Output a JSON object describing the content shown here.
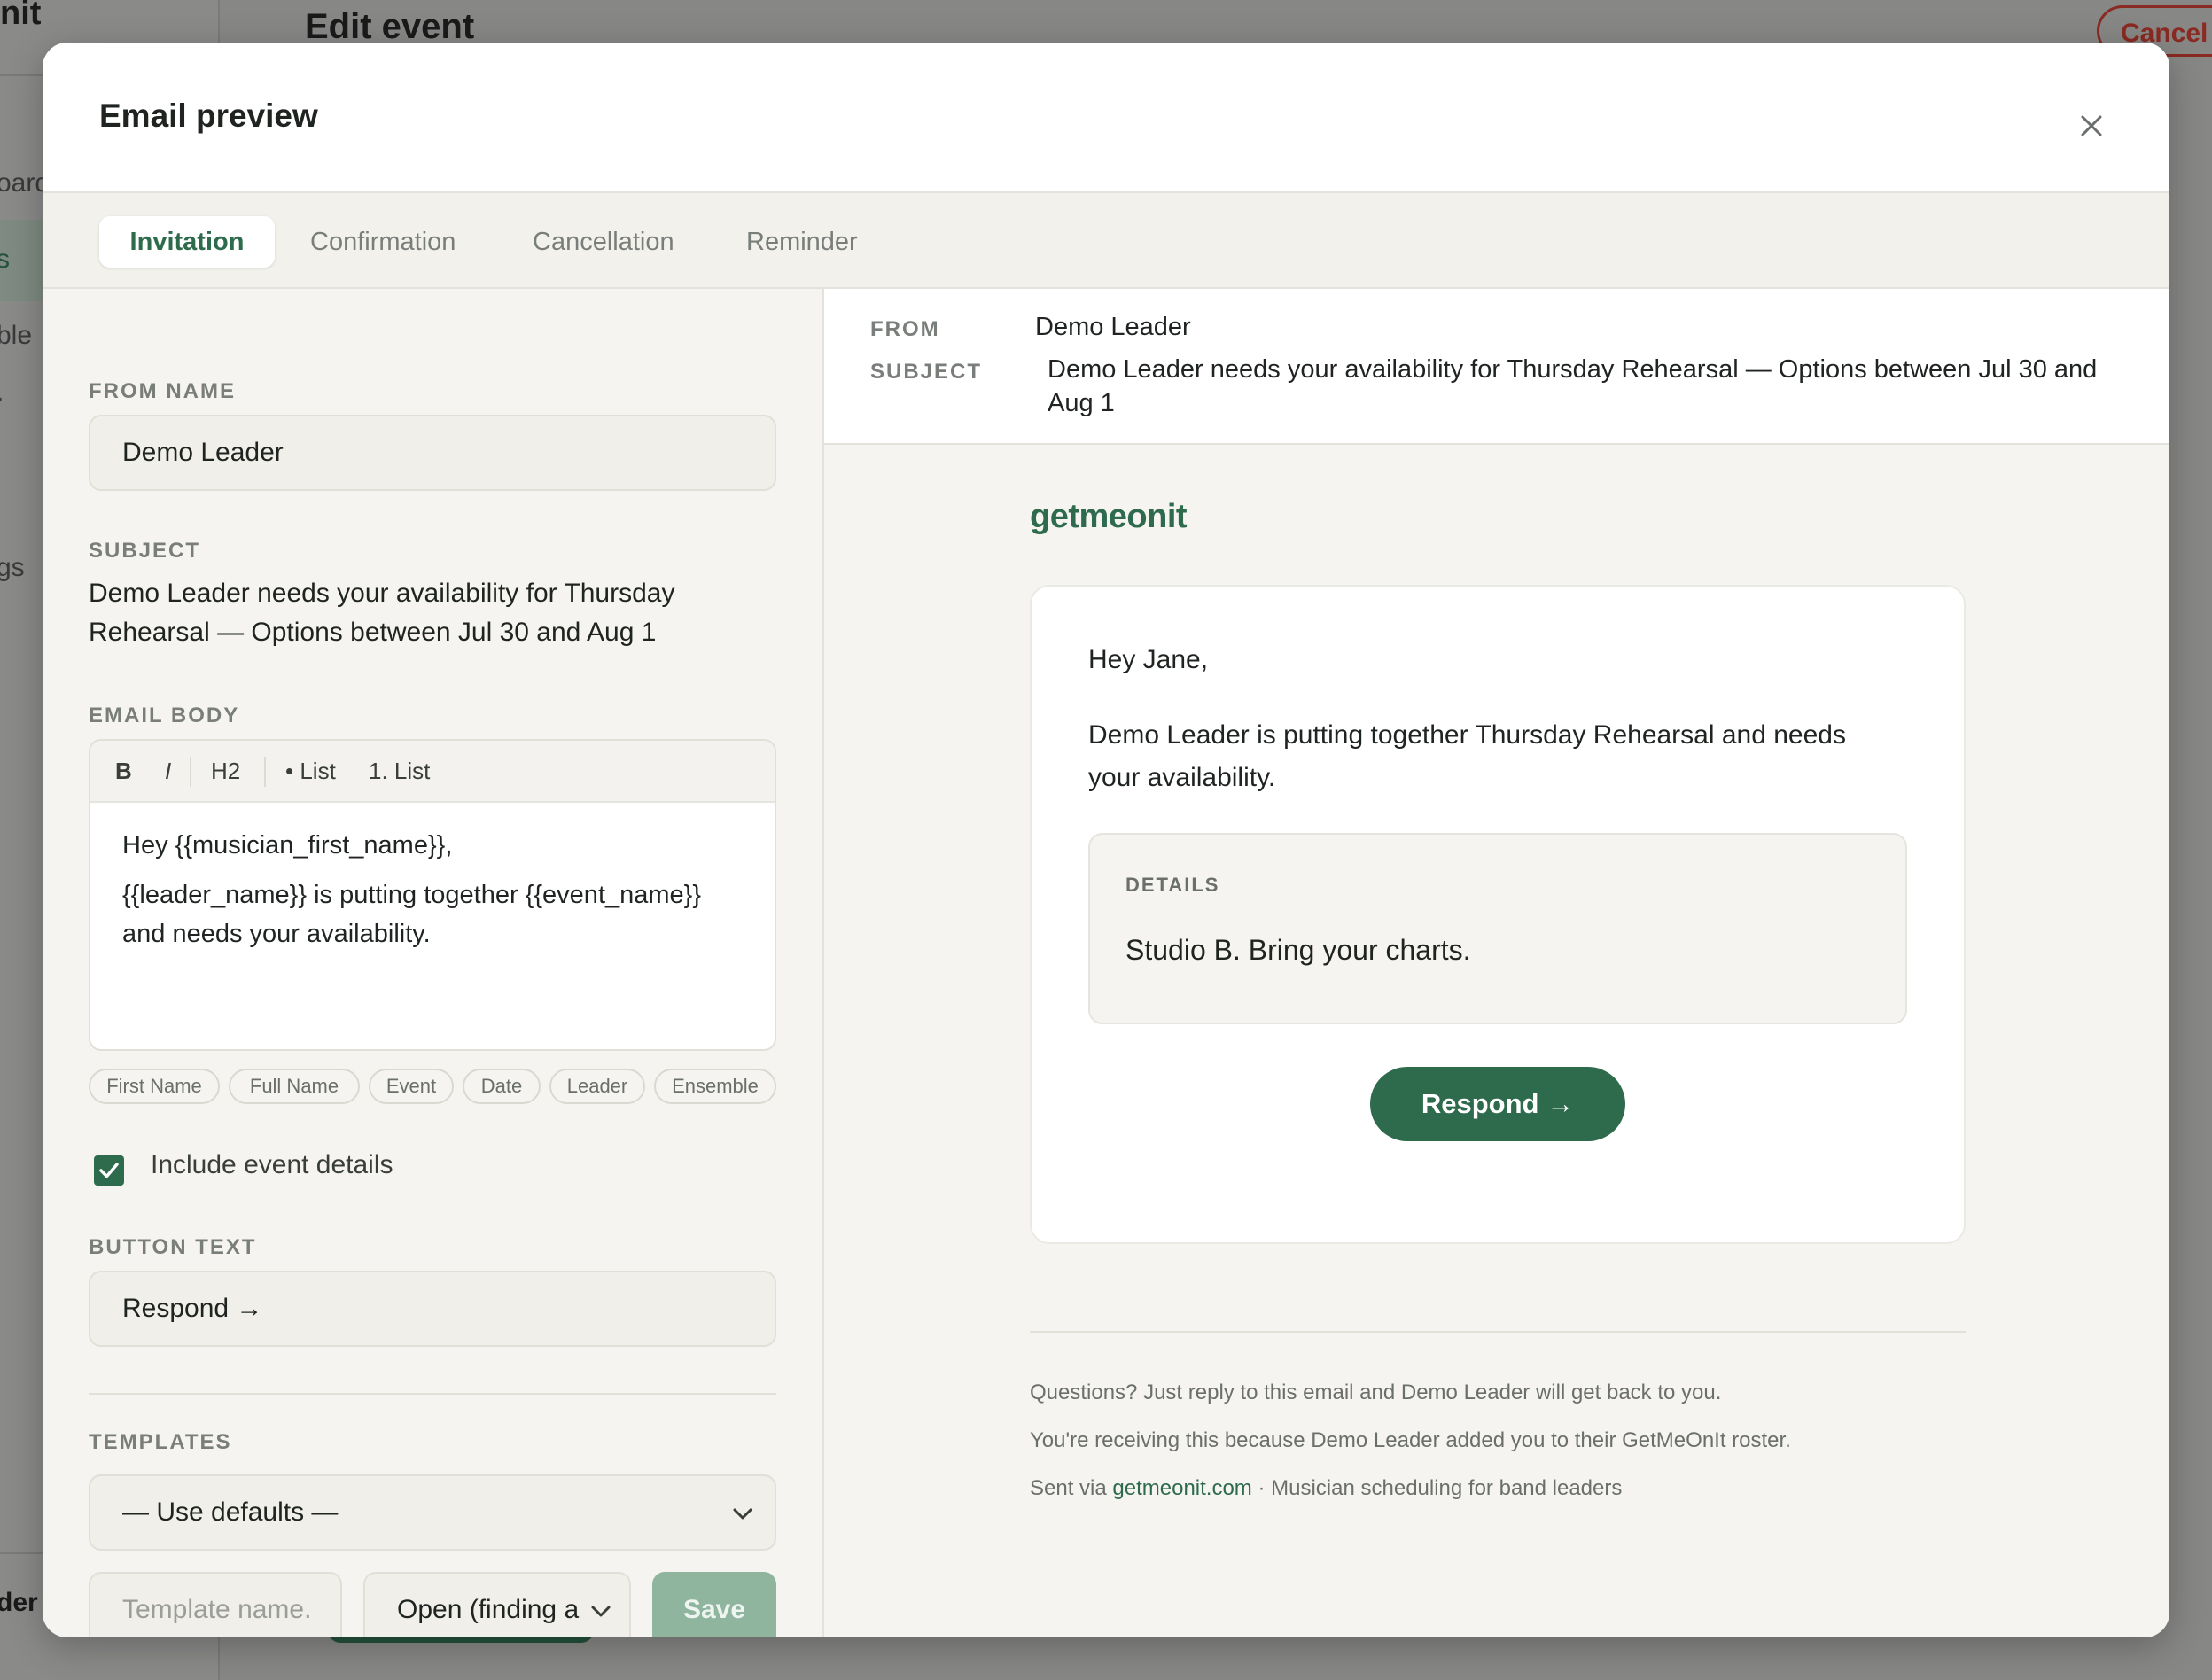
{
  "background": {
    "brand": "nit",
    "page_title": "Edit event",
    "cancel_label": "Cancel",
    "nav_fragments": [
      "oard",
      "s",
      "ble",
      ".",
      "gs"
    ],
    "user_fragment": "der"
  },
  "modal": {
    "title": "Email preview",
    "close_icon": "close-icon"
  },
  "tabs": [
    {
      "label": "Invitation",
      "active": true
    },
    {
      "label": "Confirmation",
      "active": false
    },
    {
      "label": "Cancellation",
      "active": false
    },
    {
      "label": "Reminder",
      "active": false
    }
  ],
  "form": {
    "from_name_label": "FROM NAME",
    "from_name_value": "Demo Leader",
    "subject_label": "SUBJECT",
    "subject_value": "Demo Leader needs your availability for Thursday Rehearsal — Options between Jul 30 and Aug 1",
    "email_body_label": "EMAIL BODY",
    "toolbar": {
      "bold": "B",
      "italic": "I",
      "h2": "H2",
      "bullet_list": "• List",
      "numbered_list": "1. List"
    },
    "body_lines": [
      "Hey {{musician_first_name}},",
      "{{leader_name}} is putting together {{event_name}} and needs your availability."
    ],
    "chips": [
      "First Name",
      "Full Name",
      "Event",
      "Date",
      "Leader",
      "Ensemble"
    ],
    "include_details_label": "Include event details",
    "include_details_checked": true,
    "button_text_label": "BUTTON TEXT",
    "button_text_value": "Respond →",
    "templates_label": "TEMPLATES",
    "templates_selected": "— Use defaults —",
    "template_name_placeholder": "Template name.",
    "template_status_selected": "Open (finding a",
    "save_label": "Save"
  },
  "preview": {
    "from_label": "FROM",
    "from_value": "Demo Leader",
    "subject_label": "SUBJECT",
    "subject_value": "Demo Leader needs your availability for Thursday Rehearsal — Options between Jul 30 and Aug 1",
    "brand": "getmeonit",
    "greeting": "Hey Jane,",
    "body": "Demo Leader is putting together Thursday Rehearsal and needs your availability.",
    "details_label": "DETAILS",
    "details_text": "Studio B. Bring your charts.",
    "respond_label": "Respond →",
    "footer_line1": "Questions? Just reply to this email and Demo Leader will get back to you.",
    "footer_line2": "You're receiving this because Demo Leader added you to their GetMeOnIt roster.",
    "footer_sent_via": "Sent via",
    "footer_link": "getmeonit.com",
    "footer_tagline": "· Musician scheduling for band leaders"
  },
  "colors": {
    "accent": "#2e6a4c",
    "save_disabled": "#8fb59f",
    "cancel_red": "#8a2a22"
  }
}
